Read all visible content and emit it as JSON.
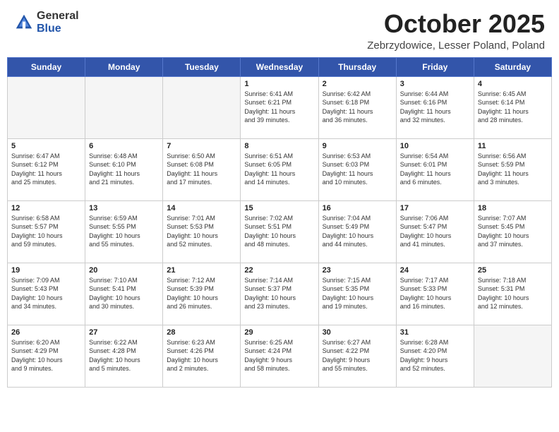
{
  "header": {
    "logo_general": "General",
    "logo_blue": "Blue",
    "month_title": "October 2025",
    "location": "Zebrzydowice, Lesser Poland, Poland"
  },
  "weekdays": [
    "Sunday",
    "Monday",
    "Tuesday",
    "Wednesday",
    "Thursday",
    "Friday",
    "Saturday"
  ],
  "weeks": [
    [
      {
        "day": "",
        "info": ""
      },
      {
        "day": "",
        "info": ""
      },
      {
        "day": "",
        "info": ""
      },
      {
        "day": "1",
        "info": "Sunrise: 6:41 AM\nSunset: 6:21 PM\nDaylight: 11 hours\nand 39 minutes."
      },
      {
        "day": "2",
        "info": "Sunrise: 6:42 AM\nSunset: 6:18 PM\nDaylight: 11 hours\nand 36 minutes."
      },
      {
        "day": "3",
        "info": "Sunrise: 6:44 AM\nSunset: 6:16 PM\nDaylight: 11 hours\nand 32 minutes."
      },
      {
        "day": "4",
        "info": "Sunrise: 6:45 AM\nSunset: 6:14 PM\nDaylight: 11 hours\nand 28 minutes."
      }
    ],
    [
      {
        "day": "5",
        "info": "Sunrise: 6:47 AM\nSunset: 6:12 PM\nDaylight: 11 hours\nand 25 minutes."
      },
      {
        "day": "6",
        "info": "Sunrise: 6:48 AM\nSunset: 6:10 PM\nDaylight: 11 hours\nand 21 minutes."
      },
      {
        "day": "7",
        "info": "Sunrise: 6:50 AM\nSunset: 6:08 PM\nDaylight: 11 hours\nand 17 minutes."
      },
      {
        "day": "8",
        "info": "Sunrise: 6:51 AM\nSunset: 6:05 PM\nDaylight: 11 hours\nand 14 minutes."
      },
      {
        "day": "9",
        "info": "Sunrise: 6:53 AM\nSunset: 6:03 PM\nDaylight: 11 hours\nand 10 minutes."
      },
      {
        "day": "10",
        "info": "Sunrise: 6:54 AM\nSunset: 6:01 PM\nDaylight: 11 hours\nand 6 minutes."
      },
      {
        "day": "11",
        "info": "Sunrise: 6:56 AM\nSunset: 5:59 PM\nDaylight: 11 hours\nand 3 minutes."
      }
    ],
    [
      {
        "day": "12",
        "info": "Sunrise: 6:58 AM\nSunset: 5:57 PM\nDaylight: 10 hours\nand 59 minutes."
      },
      {
        "day": "13",
        "info": "Sunrise: 6:59 AM\nSunset: 5:55 PM\nDaylight: 10 hours\nand 55 minutes."
      },
      {
        "day": "14",
        "info": "Sunrise: 7:01 AM\nSunset: 5:53 PM\nDaylight: 10 hours\nand 52 minutes."
      },
      {
        "day": "15",
        "info": "Sunrise: 7:02 AM\nSunset: 5:51 PM\nDaylight: 10 hours\nand 48 minutes."
      },
      {
        "day": "16",
        "info": "Sunrise: 7:04 AM\nSunset: 5:49 PM\nDaylight: 10 hours\nand 44 minutes."
      },
      {
        "day": "17",
        "info": "Sunrise: 7:06 AM\nSunset: 5:47 PM\nDaylight: 10 hours\nand 41 minutes."
      },
      {
        "day": "18",
        "info": "Sunrise: 7:07 AM\nSunset: 5:45 PM\nDaylight: 10 hours\nand 37 minutes."
      }
    ],
    [
      {
        "day": "19",
        "info": "Sunrise: 7:09 AM\nSunset: 5:43 PM\nDaylight: 10 hours\nand 34 minutes."
      },
      {
        "day": "20",
        "info": "Sunrise: 7:10 AM\nSunset: 5:41 PM\nDaylight: 10 hours\nand 30 minutes."
      },
      {
        "day": "21",
        "info": "Sunrise: 7:12 AM\nSunset: 5:39 PM\nDaylight: 10 hours\nand 26 minutes."
      },
      {
        "day": "22",
        "info": "Sunrise: 7:14 AM\nSunset: 5:37 PM\nDaylight: 10 hours\nand 23 minutes."
      },
      {
        "day": "23",
        "info": "Sunrise: 7:15 AM\nSunset: 5:35 PM\nDaylight: 10 hours\nand 19 minutes."
      },
      {
        "day": "24",
        "info": "Sunrise: 7:17 AM\nSunset: 5:33 PM\nDaylight: 10 hours\nand 16 minutes."
      },
      {
        "day": "25",
        "info": "Sunrise: 7:18 AM\nSunset: 5:31 PM\nDaylight: 10 hours\nand 12 minutes."
      }
    ],
    [
      {
        "day": "26",
        "info": "Sunrise: 6:20 AM\nSunset: 4:29 PM\nDaylight: 10 hours\nand 9 minutes."
      },
      {
        "day": "27",
        "info": "Sunrise: 6:22 AM\nSunset: 4:28 PM\nDaylight: 10 hours\nand 5 minutes."
      },
      {
        "day": "28",
        "info": "Sunrise: 6:23 AM\nSunset: 4:26 PM\nDaylight: 10 hours\nand 2 minutes."
      },
      {
        "day": "29",
        "info": "Sunrise: 6:25 AM\nSunset: 4:24 PM\nDaylight: 9 hours\nand 58 minutes."
      },
      {
        "day": "30",
        "info": "Sunrise: 6:27 AM\nSunset: 4:22 PM\nDaylight: 9 hours\nand 55 minutes."
      },
      {
        "day": "31",
        "info": "Sunrise: 6:28 AM\nSunset: 4:20 PM\nDaylight: 9 hours\nand 52 minutes."
      },
      {
        "day": "",
        "info": ""
      }
    ]
  ]
}
